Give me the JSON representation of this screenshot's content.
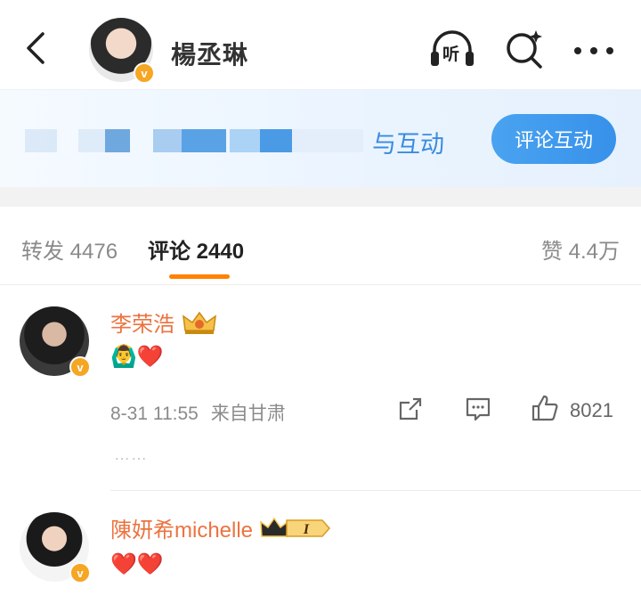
{
  "header": {
    "back_icon": "back-arrow-icon",
    "username": "楊丞琳",
    "verified_icon": "v-verified-icon",
    "listen_label": "听",
    "search_icon": "search-icon",
    "more_icon": "more-dots-icon"
  },
  "banner": {
    "text": "与互动",
    "button": "评论互动"
  },
  "tabs": {
    "forward": "转发 4476",
    "comment": "评论 2440",
    "like": "赞 4.4万",
    "accent": "#ff8200"
  },
  "comments": [
    {
      "name": "李荣浩",
      "badge_icon": "crown-badge-icon",
      "content": "🙆‍♂️❤️",
      "time": "8-31 11:55",
      "location": "来自甘肃",
      "likes": "8021",
      "more": "……"
    },
    {
      "name": "陳妍希michelle",
      "badge_icon": "crown-vip-badge-icon",
      "vip_level": "I",
      "content": "❤️❤️"
    }
  ]
}
